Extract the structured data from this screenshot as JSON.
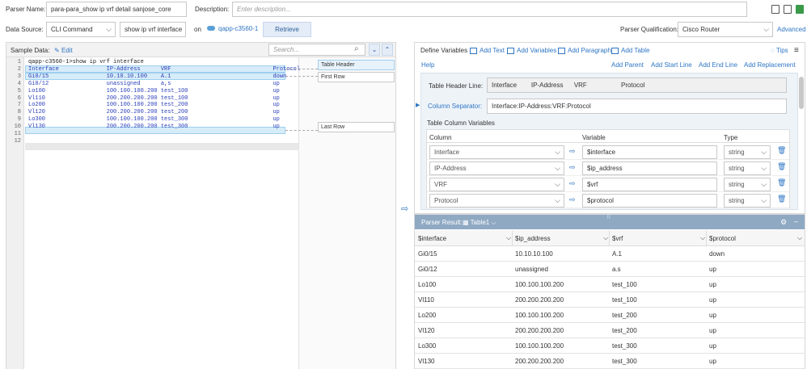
{
  "top": {
    "parser_name_label": "Parser Name:",
    "parser_name_value": "para-para_show ip vrf detail sanjose_core",
    "description_label": "Description:",
    "description_placeholder": "Enter description...",
    "data_source_label": "Data Source:",
    "data_source_value": "CLI Command",
    "command_value": "show ip vrf interface",
    "on_label": "on",
    "device_link": "qapp-c3560-1",
    "retrieve_label": "Retrieve",
    "qualification_label": "Parser Qualification:",
    "qualification_value": "Cisco Router",
    "advanced_label": "Advanced"
  },
  "sample": {
    "title": "Sample Data:",
    "edit_label": "Edit",
    "search_placeholder": "Search...",
    "line_numbers": [
      "1",
      "2",
      "3",
      "4",
      "5",
      "6",
      "7",
      "8",
      "9",
      "10",
      "11",
      "12"
    ],
    "lines": [
      "qapp-c3560-1>show ip vrf interface",
      "Interface              IP-Address      VRF                              Protocol",
      "Gi0/15                 10.10.10.100    A.1                              down",
      "Gi0/12                 unassigned      a,s                              up",
      "Lo100                  100.100.100.200 test_100                         up",
      "Vl110                  200.200.200.200 test_100                         up",
      "Lo200                  100.100.100.200 test_200                         up",
      "Vl120                  200.200.200.200 test_200                         up",
      "Lo300                  100.100.100.200 test_300                         up",
      "Vl130                  200.200.200.200 test_300                         up",
      "",
      ""
    ],
    "tags": {
      "header": "Table Header",
      "first": "First Row",
      "last": "Last Row"
    }
  },
  "define": {
    "title": "Define Variables",
    "add_text": "Add Text",
    "add_variables": "Add Variables",
    "add_paragraph": "Add Paragraph",
    "add_table": "Add Table",
    "tips": "Tips",
    "help": "Help",
    "add_parent": "Add Parent",
    "add_start_line": "Add Start Line",
    "add_end_line": "Add End Line",
    "add_replacement": "Add Replacement",
    "table_header_line_label": "Table Header Line:",
    "table_header_line_value": "Interface        IP-Address      VRF                   Protocol",
    "column_separator_label": "Column Separator:",
    "column_separator_value": "Interface:IP-Address:VRF:Protocol",
    "table_column_variables_label": "Table Column Variables",
    "col_headers": [
      "Column",
      "Variable",
      "Type"
    ],
    "rows": [
      {
        "column": "Interface",
        "variable": "$interface",
        "type": "string"
      },
      {
        "column": "IP-Address",
        "variable": "$ip_address",
        "type": "string"
      },
      {
        "column": "VRF",
        "variable": "$vrf",
        "type": "string"
      },
      {
        "column": "Protocol",
        "variable": "$protocol",
        "type": "string"
      }
    ]
  },
  "result": {
    "title": "Parser Result:",
    "table_name": "Table1",
    "headers": [
      "$interface",
      "$ip_address",
      "$vrf",
      "$protocol"
    ],
    "rows": [
      [
        "Gi0/15",
        "10.10.10.100",
        "A.1",
        "down"
      ],
      [
        "Gi0/12",
        "unassigned",
        "a.s",
        "up"
      ],
      [
        "Lo100",
        "100.100.100.200",
        "test_100",
        "up"
      ],
      [
        "Vl110",
        "200.200.200.200",
        "test_100",
        "up"
      ],
      [
        "Lo200",
        "100.100.100.200",
        "test_200",
        "up"
      ],
      [
        "Vl120",
        "200.200.200.200",
        "test_200",
        "up"
      ],
      [
        "Lo300",
        "100.100.100.200",
        "test_300",
        "up"
      ],
      [
        "Vl130",
        "200.200.200.200",
        "test_300",
        "up"
      ]
    ]
  },
  "colors": {
    "accent": "#2f76c4",
    "highlight": "#d7ecf9",
    "result_header": "#8fa9c3"
  }
}
